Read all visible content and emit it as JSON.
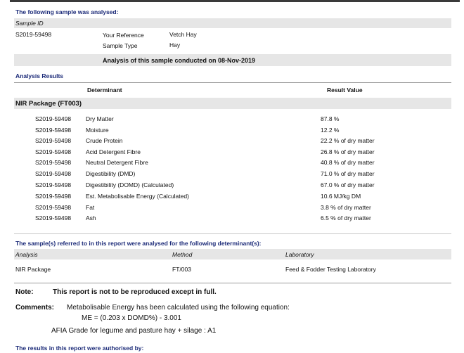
{
  "header": {
    "sample_analysed": "The following sample was analysed:",
    "sample_id_label": "Sample ID",
    "sample_id": "S2019-59498",
    "your_reference_label": "Your Reference",
    "your_reference": "Vetch Hay",
    "sample_type_label": "Sample Type",
    "sample_type": "Hay",
    "analysis_conducted": "Analysis of this sample conducted on 08-Nov-2019"
  },
  "results": {
    "title": "Analysis Results",
    "col_determinant": "Determinant",
    "col_result": "Result Value",
    "package": "NIR Package  (FT003)",
    "rows": [
      {
        "id": "S2019-59498",
        "determinant": "Dry Matter",
        "value": "87.8 %"
      },
      {
        "id": "S2019-59498",
        "determinant": "Moisture",
        "value": "12.2 %"
      },
      {
        "id": "S2019-59498",
        "determinant": "Crude Protein",
        "value": "22.2 % of dry matter"
      },
      {
        "id": "S2019-59498",
        "determinant": "Acid Detergent Fibre",
        "value": "26.8 % of dry matter"
      },
      {
        "id": "S2019-59498",
        "determinant": "Neutral Detergent Fibre",
        "value": "40.8 % of dry matter"
      },
      {
        "id": "S2019-59498",
        "determinant": "Digestibility (DMD)",
        "value": "71.0 % of dry matter"
      },
      {
        "id": "S2019-59498",
        "determinant": "Digestibility (DOMD) (Calculated)",
        "value": "67.0 % of dry matter"
      },
      {
        "id": "S2019-59498",
        "determinant": "Est. Metabolisable Energy (Calculated)",
        "value": "10.6 MJ/kg DM"
      },
      {
        "id": "S2019-59498",
        "determinant": "Fat",
        "value": "3.8 % of dry matter"
      },
      {
        "id": "S2019-59498",
        "determinant": "Ash",
        "value": "6.5 % of dry matter"
      }
    ]
  },
  "referred": {
    "title": "The sample(s) referred to in this report were analysed for the following determinant(s):",
    "col_analysis": "Analysis",
    "col_method": "Method",
    "col_laboratory": "Laboratory",
    "analysis": "NIR Package",
    "method": "FT/003",
    "laboratory": "Feed & Fodder Testing Laboratory"
  },
  "notes": {
    "note_label": "Note:",
    "note_text": "This report is not to be reproduced except in full.",
    "comments_label": "Comments:",
    "comments_line1": "Metabolisable Energy has been calculated using the following equation:",
    "comments_line2": "ME = (0.203 x DOMD%) - 3.001",
    "comments_line3": "AFIA Grade for legume and pasture hay + silage : A1"
  },
  "footer": {
    "authorised": "The results in this report were authorised by:"
  }
}
